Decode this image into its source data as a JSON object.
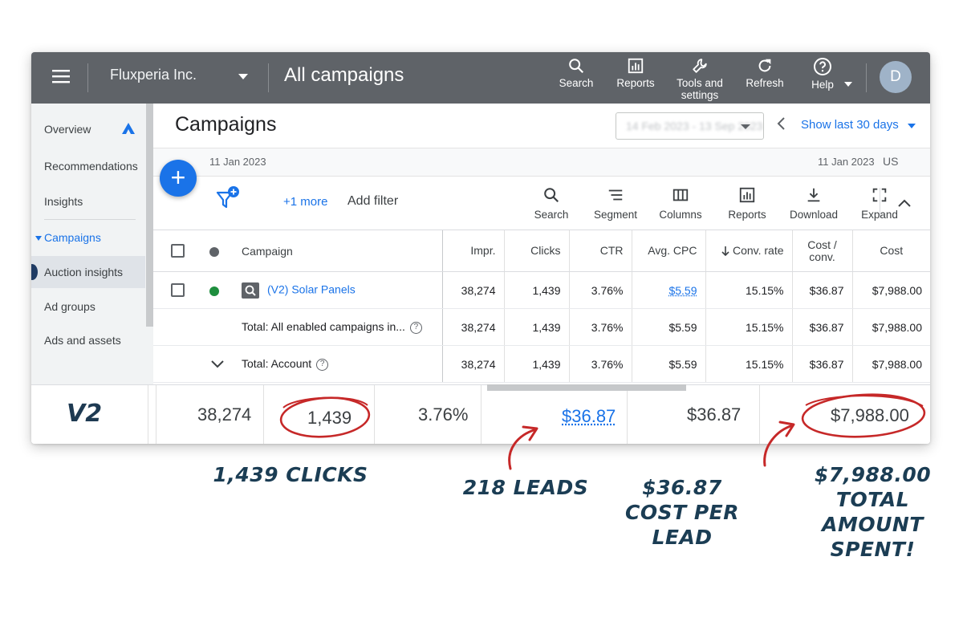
{
  "topbar": {
    "account_name": "Fluxperia Inc.",
    "page_heading": "All campaigns",
    "tools": [
      {
        "label": "Search",
        "icon": "search-icon"
      },
      {
        "label": "Reports",
        "icon": "reports-icon"
      },
      {
        "label": "Tools and settings",
        "icon": "wrench-icon"
      },
      {
        "label": "Refresh",
        "icon": "refresh-icon"
      },
      {
        "label": "Help",
        "icon": "help-icon"
      }
    ],
    "avatar_initial": "D"
  },
  "sidenav": {
    "items": [
      {
        "label": "Overview"
      },
      {
        "label": "Recommendations"
      },
      {
        "label": "Insights"
      },
      {
        "label": "Campaigns"
      },
      {
        "label": "Auction insights"
      },
      {
        "label": "Ad groups"
      },
      {
        "label": "Ads and assets"
      }
    ]
  },
  "main": {
    "title": "Campaigns",
    "date_range_blurred": "14 Feb 2023 - 13 Sep 2023",
    "show_last": "Show last 30 days",
    "date_left": "11 Jan 2023",
    "date_right": "11 Jan 2023",
    "date_tz": "US"
  },
  "filterbar": {
    "more_filter": "+1 more",
    "add_filter": "Add filter",
    "tools": [
      {
        "label": "Search",
        "icon": "search-icon"
      },
      {
        "label": "Segment",
        "icon": "segment-icon"
      },
      {
        "label": "Columns",
        "icon": "columns-icon"
      },
      {
        "label": "Reports",
        "icon": "reports-icon"
      },
      {
        "label": "Download",
        "icon": "download-icon"
      },
      {
        "label": "Expand",
        "icon": "expand-icon"
      }
    ]
  },
  "table": {
    "headers": {
      "campaign": "Campaign",
      "impr": "Impr.",
      "clicks": "Clicks",
      "ctr": "CTR",
      "avg_cpc": "Avg. CPC",
      "conv_rate": "Conv. rate",
      "cost_conv_1": "Cost /",
      "cost_conv_2": "conv.",
      "cost": "Cost"
    },
    "rows": [
      {
        "campaign": "(V2) Solar Panels",
        "impr": "38,274",
        "clicks": "1,439",
        "ctr": "3.76%",
        "avg_cpc": "$5.59",
        "conv_rate": "15.15%",
        "cost_conv": "$36.87",
        "cost": "$7,988.00"
      },
      {
        "campaign": "Total: All enabled campaigns in...",
        "impr": "38,274",
        "clicks": "1,439",
        "ctr": "3.76%",
        "avg_cpc": "$5.59",
        "conv_rate": "15.15%",
        "cost_conv": "$36.87",
        "cost": "$7,988.00"
      },
      {
        "campaign": "Total: Account",
        "impr": "38,274",
        "clicks": "1,439",
        "ctr": "3.76%",
        "avg_cpc": "$5.59",
        "conv_rate": "15.15%",
        "cost_conv": "$36.87",
        "cost": "$7,988.00"
      }
    ]
  },
  "highlight": {
    "label": "V2",
    "impr": "38,274",
    "clicks": "1,439",
    "ctr": "3.76%",
    "cost_conv_link": "$36.87",
    "cost_conv": "$36.87",
    "cost": "$7,988.00"
  },
  "annotations": {
    "clicks": "1,439 CLICKS",
    "leads": "218 LEADS",
    "cpl_1": "$36.87",
    "cpl_2": "COST PER LEAD",
    "spent_1": "$7,988.00",
    "spent_2": "TOTAL AMOUNT",
    "spent_3": "SPENT!"
  },
  "colors": {
    "topbar": "#5f6368",
    "accent": "#1a73e8",
    "annotation_ink": "#1b3d54",
    "circle_ink": "#c62828",
    "enabled_status": "#1e8e3e"
  }
}
